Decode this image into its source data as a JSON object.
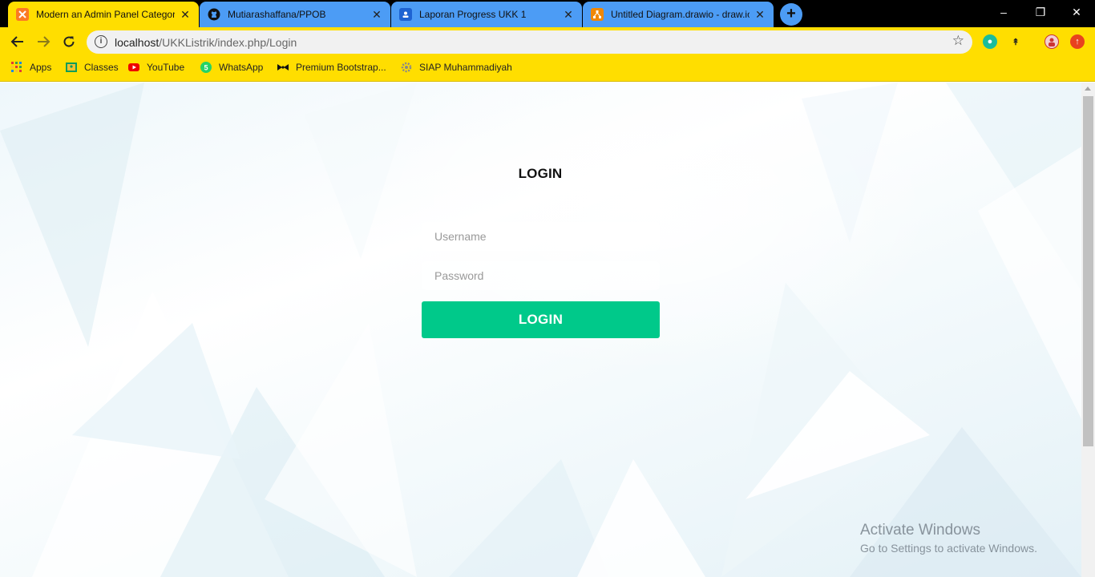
{
  "browser": {
    "tabs": [
      {
        "title": "Modern an Admin Panel Categor",
        "icon": "xampp-icon",
        "active": true
      },
      {
        "title": "Mutiarashaffana/PPOB",
        "icon": "github-icon",
        "active": false
      },
      {
        "title": "Laporan Progress UKK 1",
        "icon": "classroom-icon",
        "active": false
      },
      {
        "title": "Untitled Diagram.drawio - draw.io",
        "icon": "drawio-icon",
        "active": false
      }
    ],
    "tab_close_glyph": "✕",
    "new_tab_glyph": "+",
    "window_controls": {
      "minimize": "–",
      "restore": "❐",
      "close": "✕"
    },
    "address": {
      "host": "localhost",
      "path": "/UKKListrik/index.php/Login"
    },
    "bookmarks": [
      {
        "label": "Apps",
        "icon": "apps-grid-icon"
      },
      {
        "label": "Classes",
        "icon": "classroom-icon"
      },
      {
        "label": "YouTube",
        "icon": "youtube-icon"
      },
      {
        "label": "WhatsApp",
        "icon": "whatsapp-icon"
      },
      {
        "label": "Premium Bootstrap...",
        "icon": "bow-icon"
      },
      {
        "label": "SIAP Muhammadiyah",
        "icon": "gear-icon"
      }
    ]
  },
  "colors": {
    "browser_accent": "#ffde00",
    "inactive_tab": "#4c9cf5",
    "login_button": "#00c98a"
  },
  "login": {
    "title": "LOGIN",
    "username_placeholder": "Username",
    "password_placeholder": "Password",
    "button_label": "LOGIN"
  },
  "watermark": {
    "line1": "Activate Windows",
    "line2": "Go to Settings to activate Windows."
  }
}
